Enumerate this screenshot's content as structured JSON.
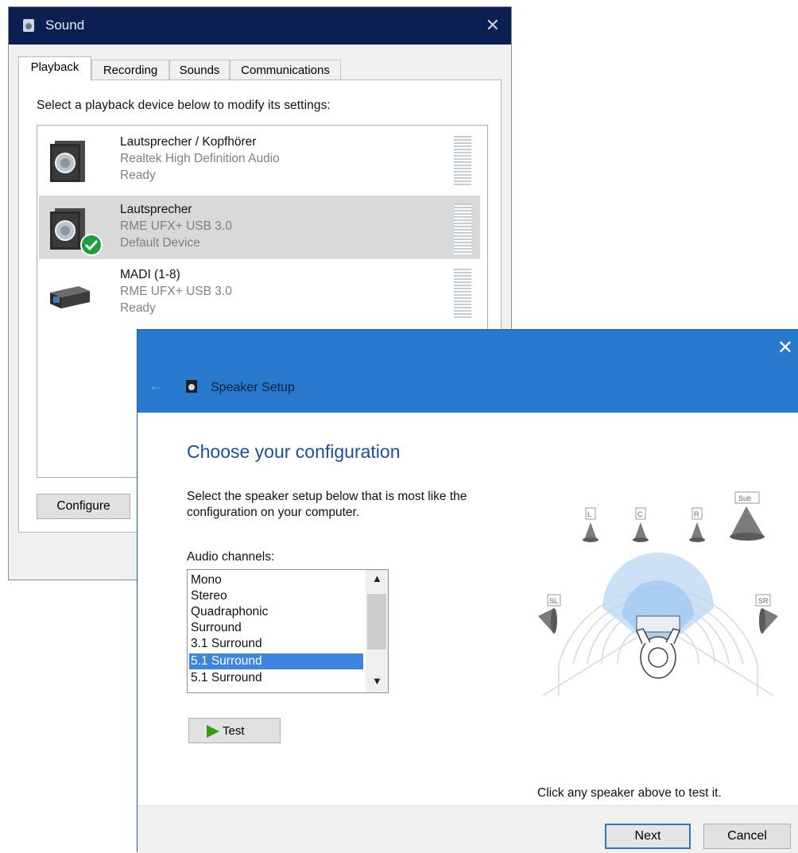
{
  "sound_dialog": {
    "title": "Sound",
    "tabs": [
      {
        "label": "Playback"
      },
      {
        "label": "Recording"
      },
      {
        "label": "Sounds"
      },
      {
        "label": "Communications"
      }
    ],
    "instruction": "Select a playback device below to modify its settings:",
    "devices": [
      {
        "name": "Lautsprecher / Kopfhörer",
        "description": "Realtek High Definition Audio",
        "status": "Ready",
        "icon": "speaker-icon"
      },
      {
        "name": "Lautsprecher",
        "description": "RME UFX+ USB 3.0",
        "status": "Default Device",
        "icon": "speaker-icon"
      },
      {
        "name": "MADI (1-8)",
        "description": "RME UFX+ USB 3.0",
        "status": "Ready",
        "icon": "audio-interface-icon"
      }
    ],
    "configure_label": "Configure"
  },
  "speaker_setup": {
    "title": "Speaker Setup",
    "heading": "Choose your configuration",
    "instruction": "Select the speaker setup below that is most like the configuration on your computer.",
    "channels_label": "Audio channels:",
    "channels": [
      "Mono",
      "Stereo",
      "Quadraphonic",
      "Surround",
      "3.1 Surround",
      "5.1 Surround",
      "5.1 Surround"
    ],
    "selected_channel": "5.1 Surround",
    "test_label": "Test",
    "speakers": {
      "left": "L",
      "center": "C",
      "right": "R",
      "sub": "Sub",
      "side_left": "SL",
      "side_right": "SR"
    },
    "test_hint": "Click any speaker above to test it.",
    "next_label": "Next",
    "cancel_label": "Cancel"
  },
  "colors": {
    "sound_titlebar": "#0b1f53",
    "setup_titlebar": "#2679cc",
    "selection": "#3d86e0",
    "default_check": "#1e9e3e",
    "heading": "#1c4f9a"
  }
}
